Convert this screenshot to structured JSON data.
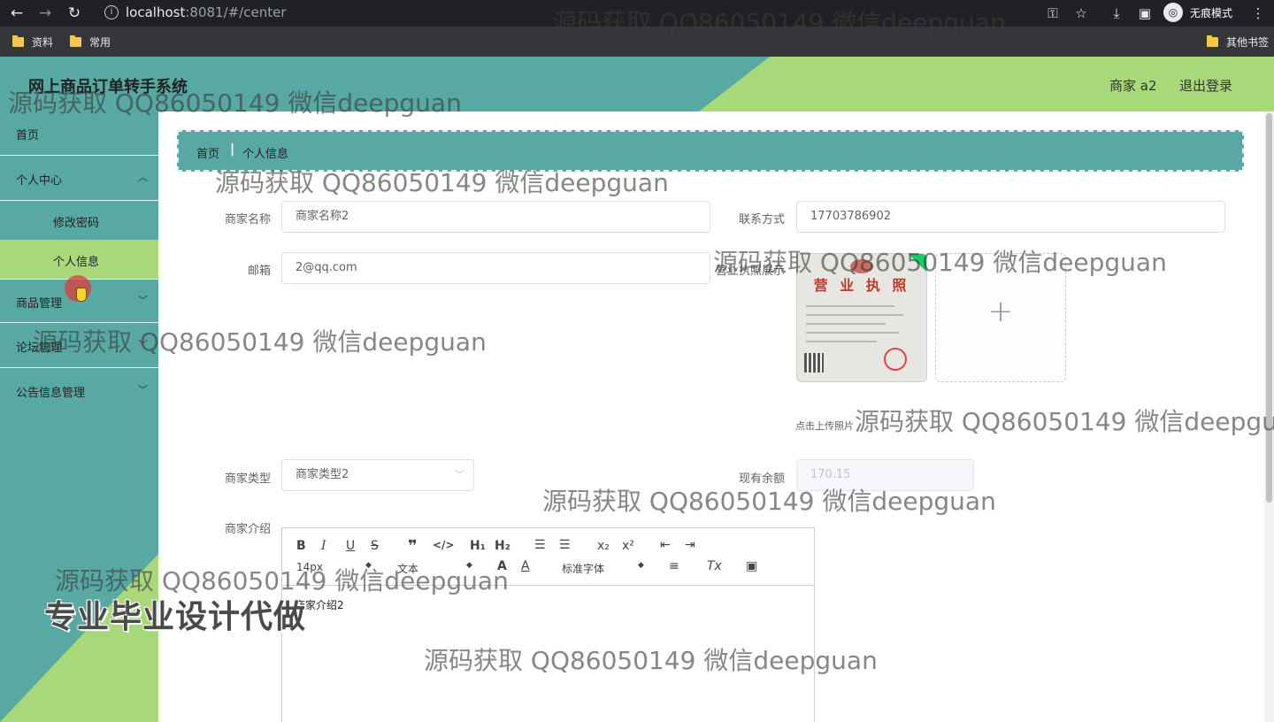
{
  "browser": {
    "url_host": "localhost",
    "url_rest": ":8081/#/center",
    "incognito_label": "无痕模式",
    "bookmarks": [
      "资料",
      "常用"
    ],
    "other_bookmarks": "其他书签"
  },
  "header": {
    "title": "网上商品订单转手系统",
    "user_label": "商家 a2",
    "logout_label": "退出登录"
  },
  "sidebar": {
    "home": "首页",
    "personal_center": "个人中心",
    "change_password": "修改密码",
    "personal_info": "个人信息",
    "product_mgmt": "商品管理",
    "forum_mgmt": "论坛管理",
    "notice_mgmt": "公告信息管理"
  },
  "breadcrumb": {
    "home": "首页",
    "current": "个人信息"
  },
  "form": {
    "name_label": "商家名称",
    "name_value": "商家名称2",
    "contact_label": "联系方式",
    "contact_value": "17703786902",
    "email_label": "邮箱",
    "email_value": "2@qq.com",
    "license_label": "营业执照展示",
    "license_image_title": "营 业 执 照",
    "upload_tip": "点击上传照片",
    "type_label": "商家类型",
    "type_value": "商家类型2",
    "balance_label": "现有余额",
    "balance_value": "170.15",
    "intro_label": "商家介绍",
    "intro_value": "商家介绍2"
  },
  "editor_toolbar": {
    "size": "14px",
    "header": "文本",
    "font": "标准字体"
  },
  "watermarks": {
    "text": "源码获取 QQ86050149 微信deepguan",
    "promo": "专业毕业设计代做"
  },
  "colors": {
    "teal": "#58a8a4",
    "green": "#a8d87a"
  }
}
